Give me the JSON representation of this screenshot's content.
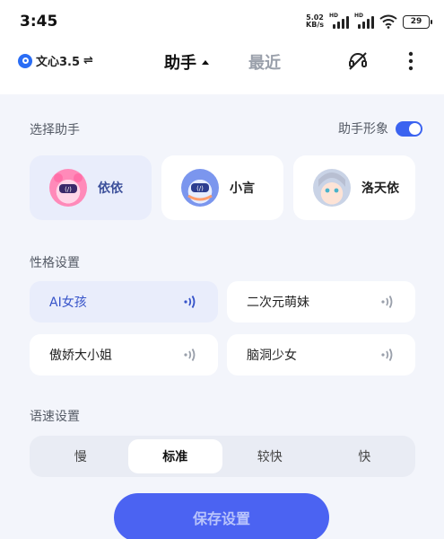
{
  "status_bar": {
    "time": "3:45",
    "net_speed_value": "5.02",
    "net_speed_unit": "KB/s",
    "hd_label": "HD",
    "battery": "29"
  },
  "header": {
    "model_name": "文心3.5",
    "model_switch_glyph": "⇌",
    "tab_assistant": "助手",
    "tab_recent": "最近"
  },
  "assistant_section": {
    "label": "选择助手",
    "persona_toggle_label": "助手形象",
    "persona_toggle_on": true,
    "assistants": [
      {
        "name": "依依",
        "selected": true,
        "avatar_color": "#ff9cc4"
      },
      {
        "name": "小言",
        "selected": false,
        "avatar_color": "#6c8df0"
      },
      {
        "name": "洛天依",
        "selected": false,
        "avatar_color": "#a9c7f2"
      }
    ]
  },
  "personality_section": {
    "label": "性格设置",
    "options": [
      {
        "label": "AI女孩",
        "selected": true
      },
      {
        "label": "二次元萌妹",
        "selected": false
      },
      {
        "label": "傲娇大小姐",
        "selected": false
      },
      {
        "label": "脑洞少女",
        "selected": false
      }
    ]
  },
  "speed_section": {
    "label": "语速设置",
    "options": [
      "慢",
      "标准",
      "较快",
      "快"
    ],
    "selected": "标准"
  },
  "save_button": "保存设置",
  "colors": {
    "accent": "#3b63f0",
    "selected_card": "#e9edfb",
    "background": "#f3f5fb"
  }
}
